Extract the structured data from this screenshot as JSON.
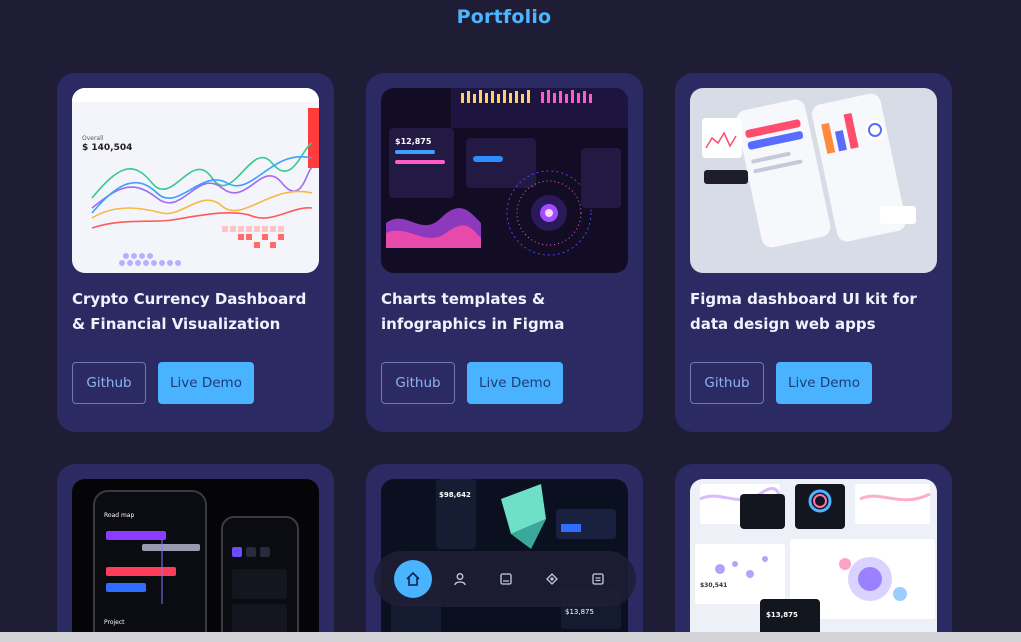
{
  "section_title": "Portfolio",
  "cards": [
    {
      "title": "Crypto Currency Dashboard & Financial Visualization",
      "github_label": "Github",
      "demo_label": "Live Demo"
    },
    {
      "title": "Charts templates & infographics in Figma",
      "github_label": "Github",
      "demo_label": "Live Demo"
    },
    {
      "title": "Figma dashboard UI kit for data design web apps",
      "github_label": "Github",
      "demo_label": "Live Demo"
    }
  ],
  "thumb_text": {
    "crypto_overall": "Overall",
    "crypto_amount": "$ 140,504",
    "charts_amount": "$12,875",
    "roadmap": "Road map",
    "project": "Project",
    "nft_amount": "$98,642",
    "nft_amount2": "$13,875",
    "figma2_amount": "$13,875",
    "figma2_amount_small": "$30,541"
  },
  "dock": {
    "items": [
      "home-icon",
      "user-icon",
      "document-icon",
      "diamond-icon",
      "list-icon"
    ]
  },
  "colors": {
    "background": "#1f1d36",
    "card": "#2b2a62",
    "accent": "#49b3ff",
    "title": "#4db5ff"
  }
}
